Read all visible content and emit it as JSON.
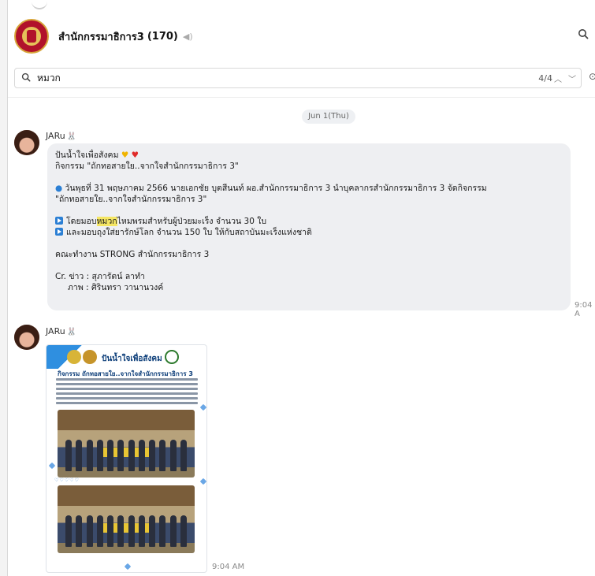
{
  "header": {
    "group_name": "สำนักกรรมาธิการ3",
    "member_count": "(170)",
    "mute_icon": "mute-icon",
    "search_icon": "search-icon"
  },
  "search": {
    "icon": "search-icon",
    "query": "หมวก",
    "match_count": "4/4",
    "up_icon": "chevron-up-icon",
    "down_icon": "chevron-down-icon"
  },
  "date_separator": "Jun 1(Thu)",
  "messages": [
    {
      "sender": "JARu",
      "time": "9:04 A",
      "lines": {
        "l1": "ปันน้ำใจเพื่อสังคม",
        "l2": "กิจกรรม \"ถักทอสายใย..จากใจสำนักกรรมาธิการ 3\"",
        "l3": "วันพุธที่ 31 พฤษภาคม 2566 นายเอกชัย  บุตสีนนท์ ผอ.สำนักกรรมาธิการ 3 นำบุคลากรสำนักกรรมาธิการ 3 จัดกิจกรรม",
        "l4": "\"ถักทอสายใย..จากใจสำนักกรรมาธิการ 3\"",
        "l5_pre": "โดยมอบ",
        "l5_hl": "หมวก",
        "l5_post": "ไหมพรมสำหรับผู้ป่วยมะเร็ง จำนวน 30 ใบ",
        "l6": "และมอบถุงใส่ยารักษ์โลก จำนวน 150 ใบ ให้กับสถาบันมะเร็งแห่งชาติ",
        "l7": "คณะทำงาน STRONG สำนักกรรมาธิการ 3",
        "l8": "Cr. ข่าว : สุภารัตน์  ลาทำ",
        "l9": "ภาพ : ศิรินทรา  วานานวงค์"
      }
    },
    {
      "sender": "JARu",
      "time": "9:04 AM",
      "image": {
        "title": "ปันน้ำใจเพื่อสังคม",
        "subtitle": "กิจกรรม ถักทอสายใย..จากใจสำนักกรรมาธิการ 3"
      }
    }
  ],
  "colors": {
    "bubble": "#eeeff2",
    "highlight": "#f5e663",
    "accent_blue": "#2b7fd4"
  }
}
